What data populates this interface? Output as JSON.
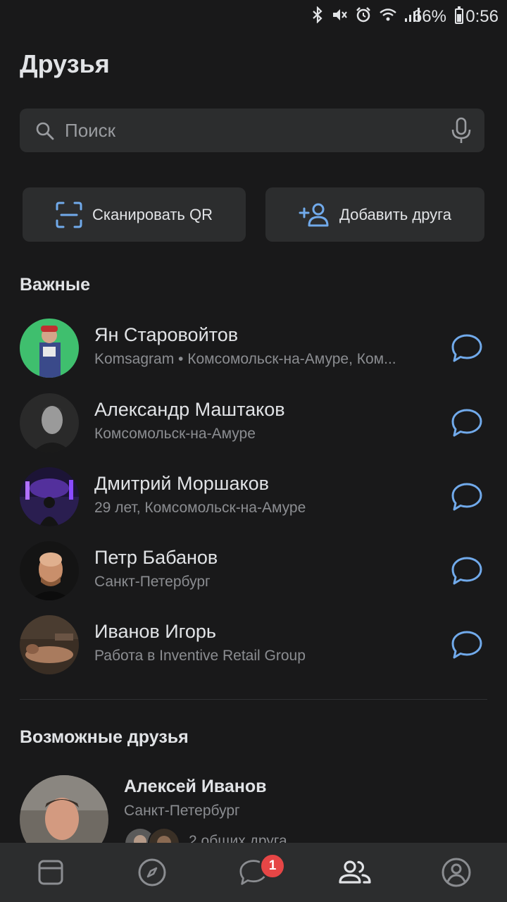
{
  "status_bar": {
    "battery": "66%",
    "time": "0:56"
  },
  "header": {
    "title": "Друзья"
  },
  "search": {
    "placeholder": "Поиск"
  },
  "actions": {
    "scan_qr": "Сканировать QR",
    "add_friend": "Добавить друга"
  },
  "important": {
    "title": "Важные",
    "friends": [
      {
        "name": "Ян Старовойтов",
        "subtitle": "Komsagram • Комсомольск-на-Амуре, Ком..."
      },
      {
        "name": "Александр Маштаков",
        "subtitle": "Комсомольск-на-Амуре"
      },
      {
        "name": "Дмитрий Моршаков",
        "subtitle": "29 лет, Комсомольск-на-Амуре"
      },
      {
        "name": "Петр Бабанов",
        "subtitle": "Санкт-Петербург"
      },
      {
        "name": "Иванов Игорь",
        "subtitle": "Работа в Inventive Retail Group"
      }
    ]
  },
  "suggestions": {
    "title": "Возможные друзья",
    "items": [
      {
        "name": "Алексей Иванов",
        "city": "Санкт-Петербург",
        "mutual": "2 общих друга"
      }
    ]
  },
  "tabbar": {
    "items": [
      "news-icon",
      "explore-icon",
      "messages-icon",
      "friends-icon",
      "profile-icon"
    ],
    "messages_badge": "1"
  },
  "colors": {
    "background": "#19191a",
    "surface": "#2c2d2e",
    "accent": "#71aaeb",
    "badge": "#e64646",
    "secondary_text": "#8b8d91"
  }
}
